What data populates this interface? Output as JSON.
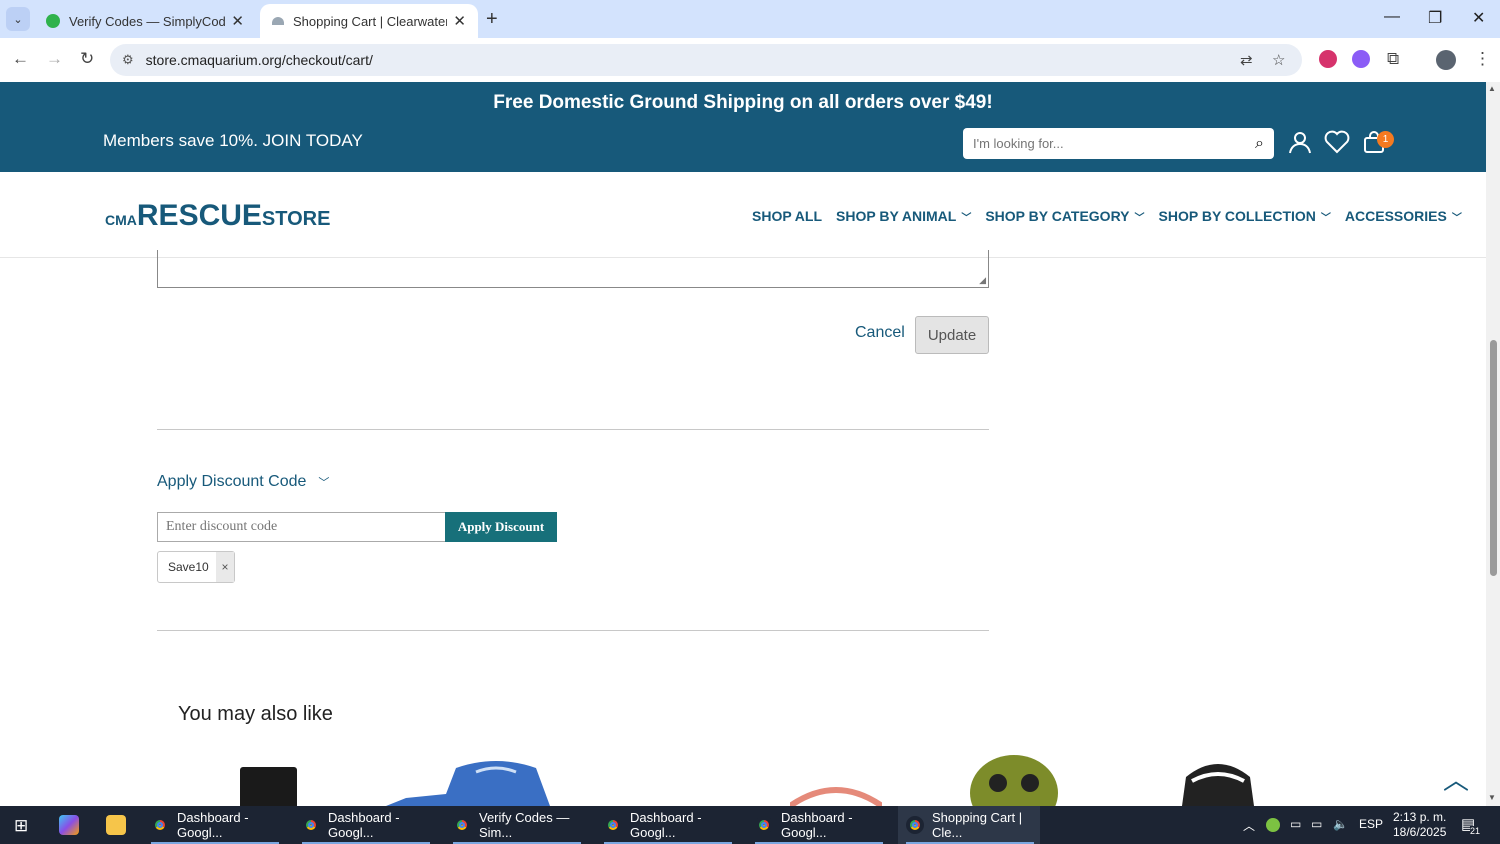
{
  "browser": {
    "tabs": [
      {
        "title": "Verify Codes — SimplyCodes",
        "active": false
      },
      {
        "title": "Shopping Cart | Clearwater Mar",
        "active": true
      }
    ],
    "url": "store.cmaquarium.org/checkout/cart/"
  },
  "site": {
    "promo_text": "Free Domestic Ground Shipping on all orders over $49!",
    "members_text": "Members save 10%. JOIN TODAY",
    "search_placeholder": "I'm looking for...",
    "cart_count": "1",
    "logo": {
      "prefix": "CMA",
      "main": "RESCUE",
      "suffix": "STORE"
    },
    "nav": [
      "SHOP ALL",
      "SHOP BY ANIMAL",
      "SHOP BY CATEGORY",
      "SHOP BY COLLECTION",
      "ACCESSORIES"
    ]
  },
  "cart": {
    "cancel_label": "Cancel",
    "update_label": "Update",
    "discount_toggle": "Apply Discount Code",
    "discount_placeholder": "Enter discount code",
    "discount_button": "Apply Discount",
    "applied_code": "Save10",
    "remove_code": "×"
  },
  "recommendations": {
    "title": "You may also like"
  },
  "taskbar": {
    "items": [
      "Dashboard - Googl...",
      "Dashboard - Googl...",
      "Verify Codes — Sim...",
      "Dashboard - Googl...",
      "Dashboard - Googl...",
      "Shopping Cart | Cle..."
    ],
    "language": "ESP",
    "time": "2:13 p. m.",
    "date": "18/6/2025",
    "notification_count": "21"
  },
  "colors": {
    "brand": "#17597a",
    "discount_button": "#17707a",
    "cart_badge": "#f47a20"
  }
}
